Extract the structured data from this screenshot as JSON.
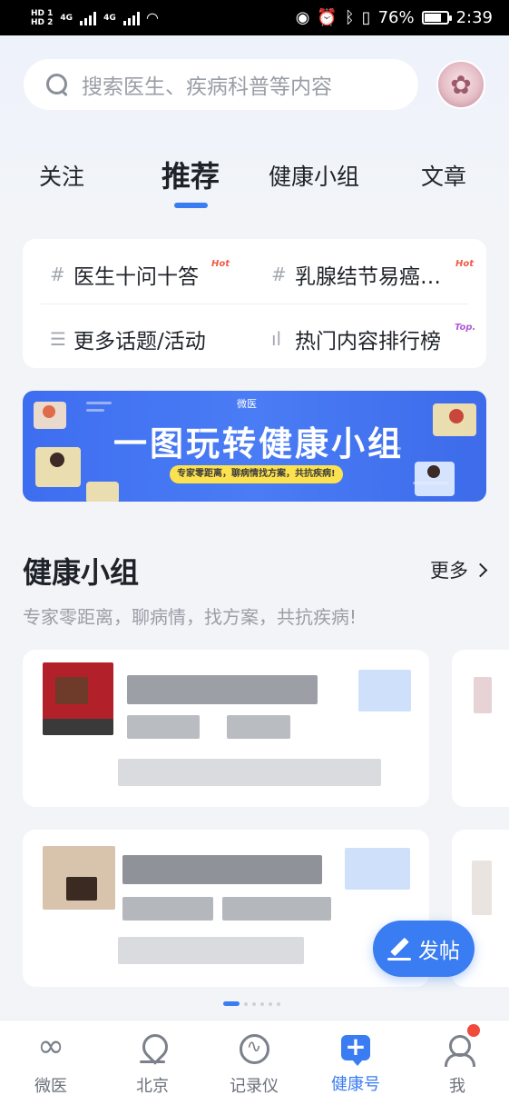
{
  "status_bar": {
    "hd1": "HD 1",
    "hd2": "HD 2",
    "net1": "4G",
    "net2": "4G",
    "battery": "76%",
    "battery_level": 0.76,
    "time": "2:39"
  },
  "search": {
    "placeholder": "搜索医生、疾病科普等内容"
  },
  "tabs": [
    {
      "label": "关注"
    },
    {
      "label": "推荐"
    },
    {
      "label": "健康小组"
    },
    {
      "label": "文章"
    }
  ],
  "topics": [
    {
      "label": "医生十问十答",
      "tag": "Hot",
      "icon": "hash-icon"
    },
    {
      "label": "乳腺结节易癌…",
      "tag": "Hot",
      "icon": "hash-icon"
    },
    {
      "label": "更多话题/活动",
      "icon": "list-icon"
    },
    {
      "label": "热门内容排行榜",
      "tag": "Top.",
      "icon": "bar-chart-icon"
    }
  ],
  "banner": {
    "logo": "微医",
    "title": "一图玩转健康小组",
    "subtitle": "专家零距离，聊病情找方案，共抗疾病!"
  },
  "section": {
    "title": "健康小组",
    "more": "更多",
    "subtitle": "专家零距离，聊病情，找方案，共抗疾病!"
  },
  "fab": {
    "label": "发帖"
  },
  "bottom_nav": [
    {
      "label": "微医",
      "icon": "weiyi-logo-icon"
    },
    {
      "label": "北京",
      "icon": "location-pin-icon"
    },
    {
      "label": "记录仪",
      "icon": "pulse-icon"
    },
    {
      "label": "健康号",
      "icon": "plus-message-icon"
    },
    {
      "label": "我",
      "icon": "profile-icon"
    }
  ],
  "colors": {
    "accent": "#3a7cf2",
    "hot": "#f05a4a",
    "top": "#b35ad6",
    "badge": "#f04a3c",
    "banner_bg": "#4a7cf5"
  }
}
